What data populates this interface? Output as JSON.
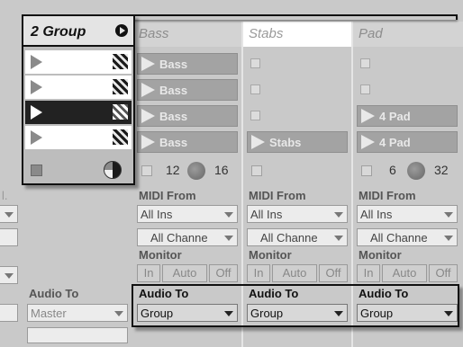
{
  "group_track": {
    "title": "2 Group",
    "fold_icon": "fold-arrow-icon",
    "slots": [
      {
        "state": "idle"
      },
      {
        "state": "idle"
      },
      {
        "state": "playing"
      },
      {
        "state": "idle"
      }
    ]
  },
  "tracks": [
    {
      "name": "Bass",
      "clips": [
        "Bass",
        "Bass",
        "Bass",
        "Bass"
      ],
      "stop_counter_left": "12",
      "stop_counter_right": "16",
      "midi_from_label": "MIDI From",
      "midi_from_value": "All Ins",
      "channel_value": "All Channe",
      "monitor_label": "Monitor",
      "monitor_options": [
        "In",
        "Auto",
        "Off"
      ],
      "audio_to_label": "Audio To",
      "audio_to_value": "Group"
    },
    {
      "name": "Stabs",
      "clips": [
        "",
        "",
        "",
        "Stabs"
      ],
      "midi_from_label": "MIDI From",
      "midi_from_value": "All Ins",
      "channel_value": "All Channe",
      "monitor_label": "Monitor",
      "monitor_options": [
        "In",
        "Auto",
        "Off"
      ],
      "audio_to_label": "Audio To",
      "audio_to_value": "Group"
    },
    {
      "name": "Pad",
      "clips": [
        "",
        "",
        "4 Pad",
        "4 Pad"
      ],
      "stop_counter_left": "6",
      "stop_counter_right": "32",
      "midi_from_label": "MIDI From",
      "midi_from_value": "All Ins",
      "channel_value": "All Channe",
      "monitor_label": "Monitor",
      "monitor_options": [
        "In",
        "Auto",
        "Off"
      ],
      "audio_to_label": "Audio To",
      "audio_to_value": "Group"
    }
  ],
  "group_io": {
    "audio_to_label": "Audio To",
    "audio_to_value": "Master"
  },
  "left_edge_fragment": "l."
}
